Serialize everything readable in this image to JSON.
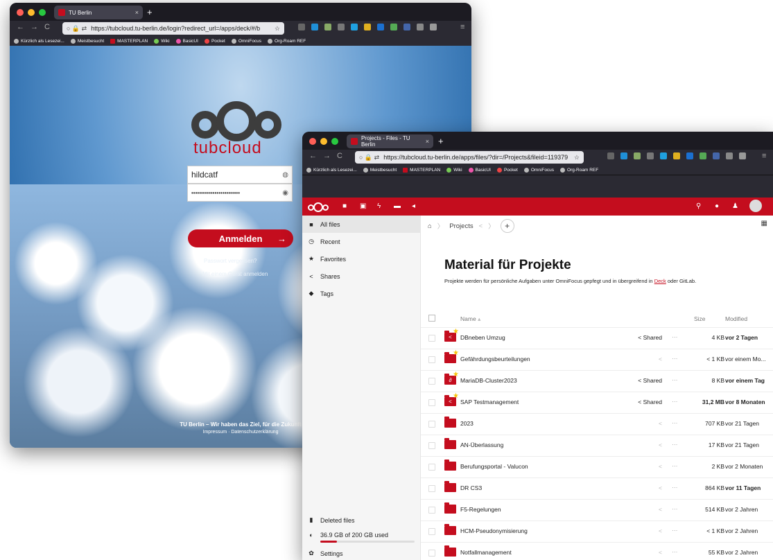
{
  "login_window": {
    "tab_title": "TU Berlin",
    "url": "https://tubcloud.tu-berlin.de/login?redirect_url=/apps/deck/#/b",
    "brand": "tubcloud",
    "username_value": "hildcatf",
    "password_mask": "•••••••••••••••••••••••••",
    "login_label": "Anmelden",
    "forgot_label": "Passwort vergessen?",
    "device_label": "Mit einem Gerät anmelden",
    "footer_line": "TU Berlin – Wir haben das Ziel, für die Zukunft",
    "footer_links": "Impressum · Datenschutzerklärung"
  },
  "files_window": {
    "tab_title": "Projects - Files - TU Berlin",
    "url": "https://tubcloud.tu-berlin.de/apps/files/?dir=/Projects&fileid=119379"
  },
  "bookmarks": [
    "Kürzlich als Lesezei...",
    "Meistbesucht",
    "MASTERPLAN",
    "Wiki",
    "BasicUI",
    "Pocket",
    "OmniFocus",
    "Org-Roam REF"
  ],
  "sidebar": {
    "items": [
      {
        "icon": "■",
        "label": "All files"
      },
      {
        "icon": "◷",
        "label": "Recent"
      },
      {
        "icon": "★",
        "label": "Favorites"
      },
      {
        "icon": "<",
        "label": "Shares"
      },
      {
        "icon": "◆",
        "label": "Tags"
      }
    ],
    "deleted_label": "Deleted files",
    "quota_label": "36.9 GB of 200 GB used",
    "quota_fraction": 0.18,
    "settings_label": "Settings"
  },
  "breadcrumb": {
    "folder": "Projects"
  },
  "page": {
    "title": "Material für Projekte",
    "desc_before": "Projekte werden für persönliche Aufgaben unter OmniFocus gepfegt und in übergreifend in ",
    "desc_link": "Deck",
    "desc_after": " oder GitLab."
  },
  "table": {
    "col_name": "Name",
    "col_size": "Size",
    "col_modified": "Modified",
    "rows": [
      {
        "name": "DBneben Umzug",
        "share": "Shared",
        "size": "4 KB",
        "modified": "vor 2 Tagen"
      },
      {
        "name": "Gefährdungsbeurteilungen",
        "share": "",
        "size": "< 1 KB",
        "modified": "vor einem Mo..."
      },
      {
        "name": "MariaDB-Cluster2023",
        "share": "Shared",
        "size": "8 KB",
        "modified": "vor einem Tag"
      },
      {
        "name": "SAP Testmanagement",
        "share": "Shared",
        "size": "31,2 MB",
        "modified": "vor 8 Monaten"
      },
      {
        "name": "2023",
        "share": "",
        "size": "707 KB",
        "modified": "vor 21 Tagen"
      },
      {
        "name": "AN-Überlassung",
        "share": "",
        "size": "17 KB",
        "modified": "vor 21 Tagen"
      },
      {
        "name": "Berufungsportal - Valucon",
        "share": "",
        "size": "2 KB",
        "modified": "vor 2 Monaten"
      },
      {
        "name": "DR CS3",
        "share": "",
        "size": "864 KB",
        "modified": "vor 11 Tagen"
      },
      {
        "name": "F5-Regelungen",
        "share": "",
        "size": "514 KB",
        "modified": "vor 2 Jahren"
      },
      {
        "name": "HCM-Pseudonymisierung",
        "share": "",
        "size": "< 1 KB",
        "modified": "vor 2 Jahren"
      },
      {
        "name": "Notfallmanagement",
        "share": "",
        "size": "55 KB",
        "modified": "vor 2 Jahren"
      }
    ]
  }
}
